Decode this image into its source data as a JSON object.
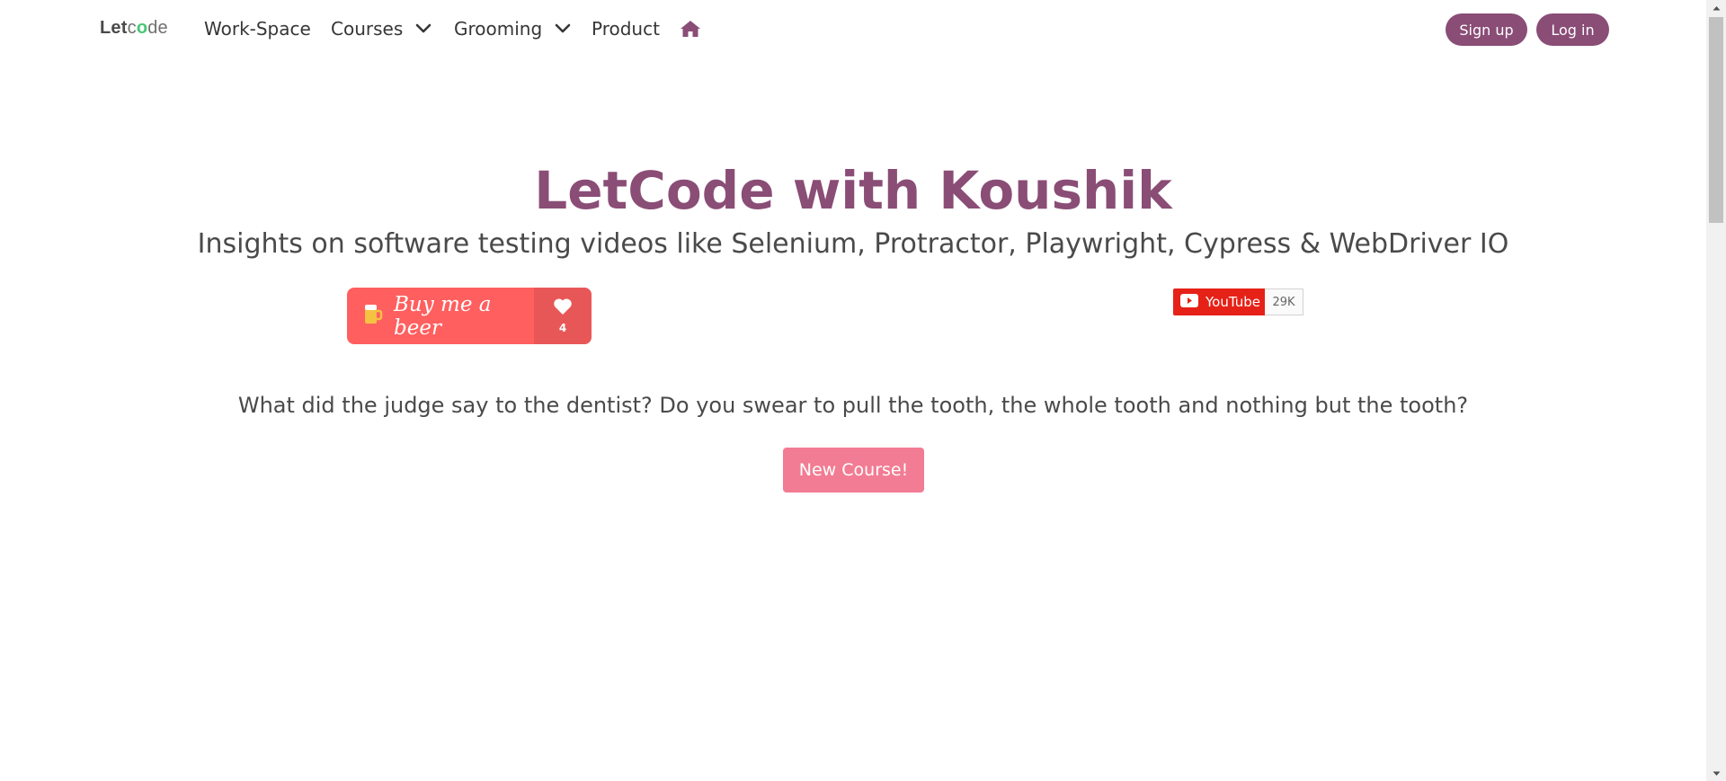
{
  "navbar": {
    "logo": {
      "part1": "Let",
      "part2": "c",
      "part3": "o",
      "part4": "de"
    },
    "items": [
      {
        "label": "Work-Space"
      },
      {
        "label": "Courses"
      },
      {
        "label": "Grooming"
      },
      {
        "label": "Product"
      }
    ],
    "home_icon": "home-icon",
    "signup_label": "Sign up",
    "login_label": "Log in"
  },
  "hero": {
    "title": "LetCode with Koushik",
    "subtitle": "Insights on software testing videos like Selenium, Protractor, Playwright, Cypress & WebDriver IO"
  },
  "beer": {
    "label": "Buy me a beer",
    "count": "4",
    "icon": "beer-mug-icon"
  },
  "youtube": {
    "label": "YouTube",
    "count": "29K"
  },
  "joke": "What did the judge say to the dentist? Do you swear to pull the tooth, the whole tooth and nothing but the tooth?",
  "new_course_label": "New Course!",
  "colors": {
    "brand": "#8a4d76",
    "beer": "#ff5f5f",
    "new_course": "#f27c93",
    "youtube": "#e62117"
  }
}
